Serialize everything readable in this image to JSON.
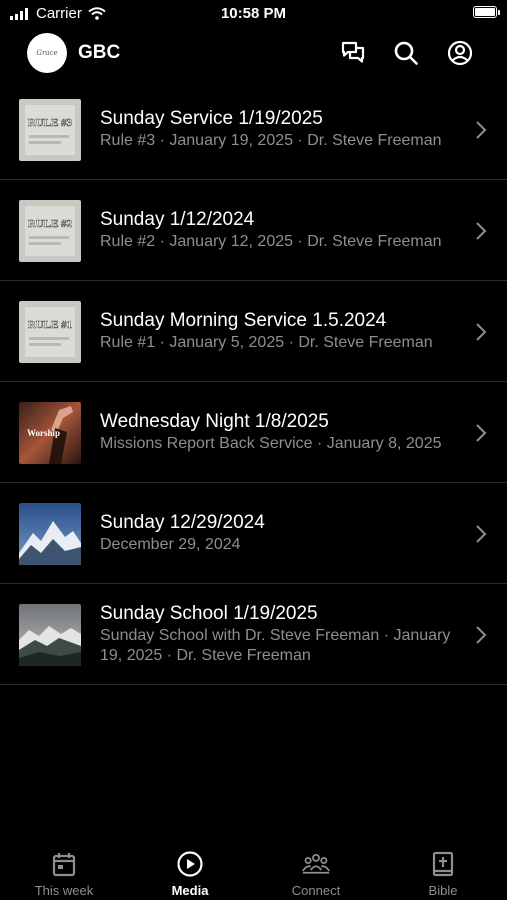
{
  "status_bar": {
    "carrier": "Carrier",
    "time": "10:58 PM"
  },
  "header": {
    "logo_text": "Grace",
    "title": "GBC",
    "icons": [
      "chat-icon",
      "search-icon",
      "account-icon"
    ]
  },
  "media_items": [
    {
      "title": "Sunday Service 1/19/2025",
      "subtitle": "Rule #3 · January 19, 2025 · Dr. Steve Freeman",
      "thumb_label": "RULE #3"
    },
    {
      "title": "Sunday 1/12/2024",
      "subtitle": "Rule #2 · January 12, 2025 · Dr. Steve Freeman",
      "thumb_label": "RULE #2"
    },
    {
      "title": "Sunday Morning Service 1.5.2024",
      "subtitle": "Rule #1 · January 5, 2025 · Dr. Steve Freeman",
      "thumb_label": "RULE #1"
    },
    {
      "title": "Wednesday Night 1/8/2025",
      "subtitle": "Missions Report Back Service · January 8, 2025",
      "thumb_label": "Worship"
    },
    {
      "title": "Sunday 12/29/2024",
      "subtitle": "December 29, 2024",
      "thumb_label": ""
    },
    {
      "title": "Sunday School 1/19/2025",
      "subtitle": "Sunday School with Dr. Steve Freeman · January 19, 2025 · Dr. Steve Freeman",
      "thumb_label": ""
    }
  ],
  "tab_bar": {
    "tabs": [
      {
        "label": "This week",
        "icon": "calendar-icon"
      },
      {
        "label": "Media",
        "icon": "play-circle-icon"
      },
      {
        "label": "Connect",
        "icon": "people-icon"
      },
      {
        "label": "Bible",
        "icon": "bible-icon"
      }
    ],
    "active": "Media"
  }
}
